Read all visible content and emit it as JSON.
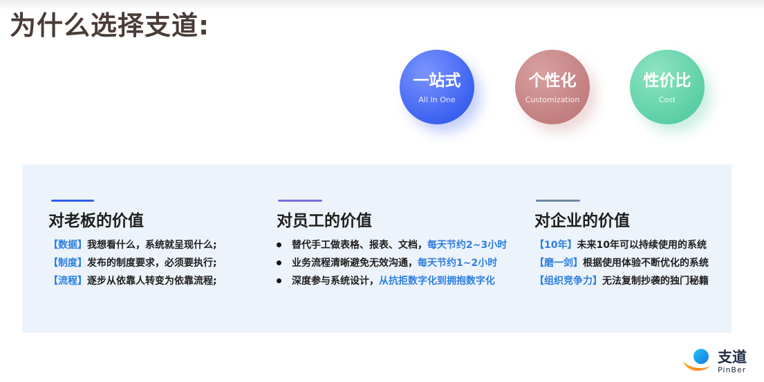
{
  "page": {
    "title": "为什么选择支道:"
  },
  "badges": [
    {
      "main": "一站式",
      "sub": "All In One",
      "color": "#3c62f0"
    },
    {
      "main": "个性化",
      "sub": "Customization",
      "color": "#c27f80"
    },
    {
      "main": "性价比",
      "sub": "Cost",
      "color": "#5dcfa6"
    }
  ],
  "columns": {
    "boss": {
      "title": "对老板的价值",
      "accent": "#2f5bea",
      "rows": [
        {
          "tag": "【数据】",
          "text": "我想看什么，系统就呈现什么;"
        },
        {
          "tag": "【制度】",
          "text": "发布的制度要求，必须要执行;"
        },
        {
          "tag": "【流程】",
          "text": "逐步从依靠人转变为依靠流程;"
        }
      ]
    },
    "staff": {
      "title": "对员工的价值",
      "accent": "#7b6be0",
      "rows": [
        {
          "text": "替代手工做表格、报表、文档，",
          "highlight": "每天节约2~3小时"
        },
        {
          "text": "业务流程清晰避免无效沟通，",
          "highlight": "每天节约1~2小时"
        },
        {
          "text": "深度参与系统设计，",
          "highlight": "从抗拒数字化到拥抱数字化"
        }
      ]
    },
    "company": {
      "title": "对企业的价值",
      "accent": "#6e86a6",
      "rows": [
        {
          "tag": "【10年】",
          "text": "未来10年可以持续使用的系统"
        },
        {
          "tag": "【磨一剑】",
          "text": "根据使用体验不断优化的系统"
        },
        {
          "tag": "【组织竞争力】",
          "text": "无法复制抄袭的独门秘籍"
        }
      ]
    }
  },
  "logo": {
    "name": "支道",
    "en": "PinBer",
    "icon": "pinber-logo-mark"
  },
  "colors": {
    "title": "#4a3c38",
    "highlight": "#2d7fe0",
    "panel_bg": "#edf3fb"
  }
}
